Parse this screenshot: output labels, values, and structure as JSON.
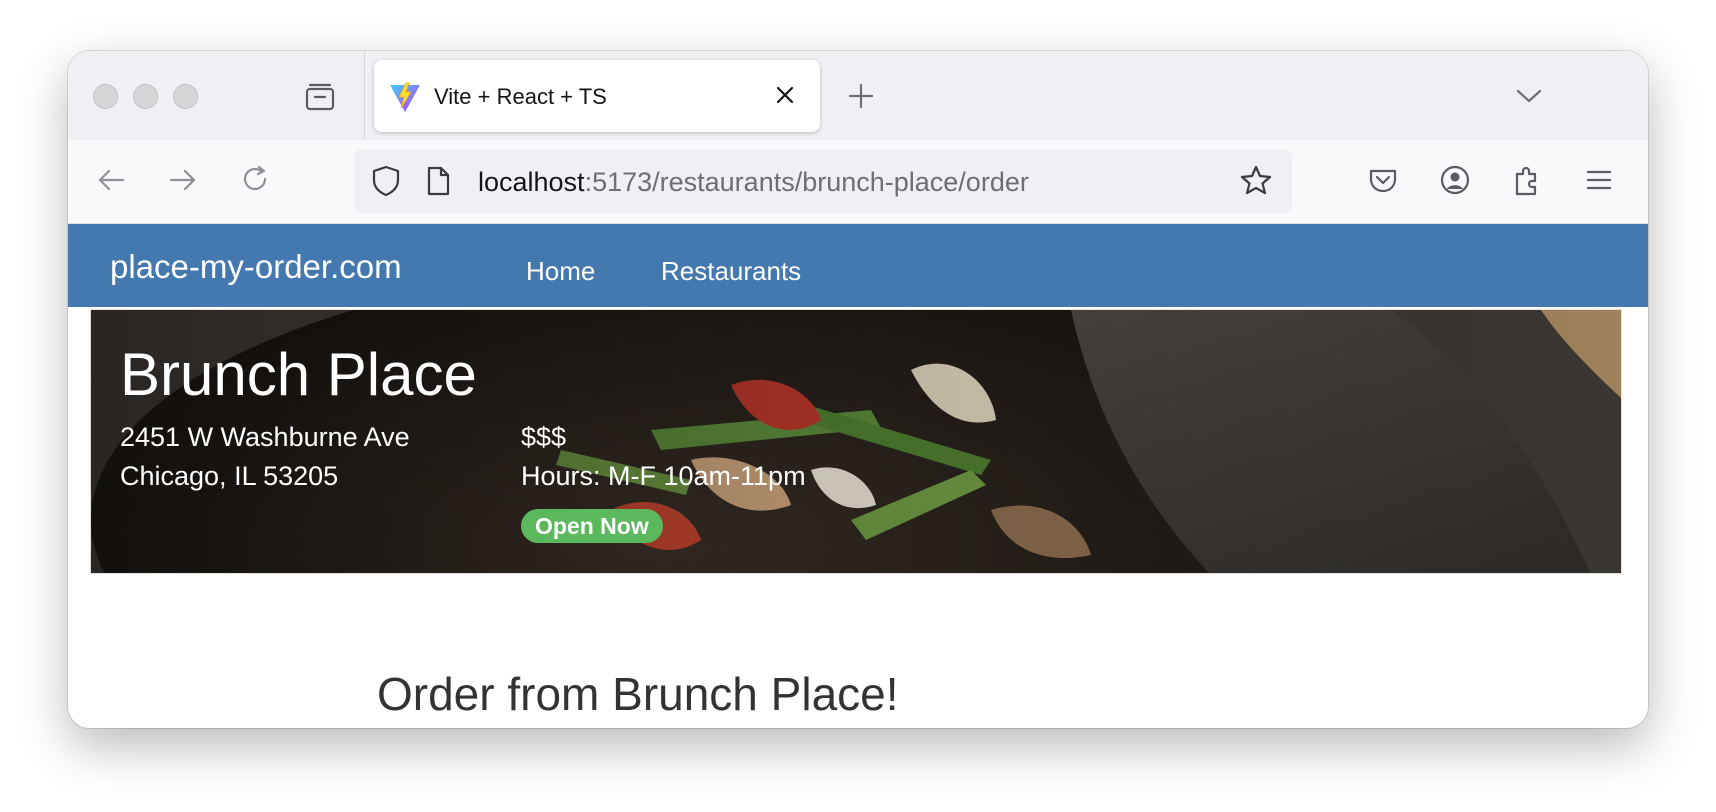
{
  "browser": {
    "tab": {
      "title": "Vite + React + TS",
      "favicon": "vite-logo-icon"
    },
    "url": {
      "host": "localhost",
      "path": ":5173/restaurants/brunch-place/order"
    },
    "icons": [
      "back-icon",
      "forward-icon",
      "reload-icon",
      "shield-icon",
      "page-icon",
      "bookmark-star-icon",
      "pocket-icon",
      "account-icon",
      "extensions-icon",
      "menu-icon",
      "tab-list-icon",
      "close-icon",
      "new-tab-icon",
      "chevron-down-icon"
    ]
  },
  "navbar": {
    "brand": "place-my-order.com",
    "links": [
      {
        "label": "Home"
      },
      {
        "label": "Restaurants"
      }
    ],
    "color": "#4479b0"
  },
  "restaurant": {
    "name": "Brunch Place",
    "address_line1": "2451 W Washburne Ave",
    "address_line2": "Chicago, IL 53205",
    "price": "$$$",
    "hours": "Hours: M-F 10am-11pm",
    "status": "Open Now",
    "status_color": "#5cb85c"
  },
  "main": {
    "heading": "Order from Brunch Place!"
  }
}
